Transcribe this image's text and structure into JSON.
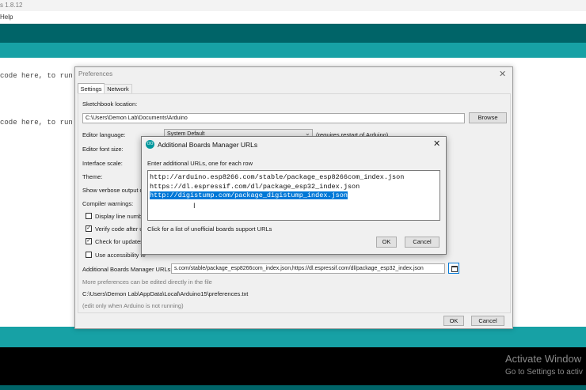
{
  "ide": {
    "title": "s 1.8.12",
    "menu_help": "Help",
    "code_lines": [
      "code here, to run o",
      "code here, to run re"
    ]
  },
  "prefs": {
    "title": "Preferences",
    "close": "✕",
    "tabs": [
      "Settings",
      "Network"
    ],
    "sketchbook_label": "Sketchbook location:",
    "sketchbook_value": "C:\\Users\\Demon Lab\\Documents\\Arduino",
    "browse_label": "Browse",
    "editor_language_label": "Editor language:",
    "editor_language_value": "System Default",
    "editor_language_note": "(requires restart of Arduino)",
    "font_size_label": "Editor font size:",
    "interface_scale_label": "Interface scale:",
    "theme_label": "Theme:",
    "verbose_label": "Show verbose output d",
    "compiler_warnings_label": "Compiler warnings:",
    "checkboxes": [
      {
        "label": "Display line number",
        "checked": false
      },
      {
        "label": "Verify code after u",
        "checked": true
      },
      {
        "label": "Check for updates",
        "checked": true
      },
      {
        "label": "Use accessibility fe",
        "checked": false
      }
    ],
    "abm_label": "Additional Boards Manager URLs:",
    "abm_value": "s.com/stable/package_esp8266com_index.json,https://dl.espressif.com/dl/package_esp32_index.json",
    "more_prefs_note": "More preferences can be edited directly in the file",
    "prefs_path": "C:\\Users\\Demon Lab\\AppData\\Local\\Arduino15\\preferences.txt",
    "edit_note": "(edit only when Arduino is not running)",
    "ok_label": "OK",
    "cancel_label": "Cancel"
  },
  "abm_dialog": {
    "icon_text": "OO",
    "title": "Additional Boards Manager URLs",
    "close": "✕",
    "instruction": "Enter additional URLs, one for each row",
    "urls": [
      "http://arduino.esp8266.com/stable/package_esp8266com_index.json",
      "https://dl.espressif.com/dl/package_esp32_index.json",
      "http://digistump.com/package_digistump_index.json"
    ],
    "selected_url_index": 2,
    "unofficial_link": "Click for a list of unofficial boards support URLs",
    "ok_label": "OK",
    "cancel_label": "Cancel"
  },
  "watermark": {
    "title": "Activate Window",
    "subtitle": "Go to Settings to activ"
  },
  "colors": {
    "toolbar": "#006468",
    "tabs": "#17a1a5",
    "selection": "#0078d7",
    "arduino_icon": "#00979c"
  }
}
